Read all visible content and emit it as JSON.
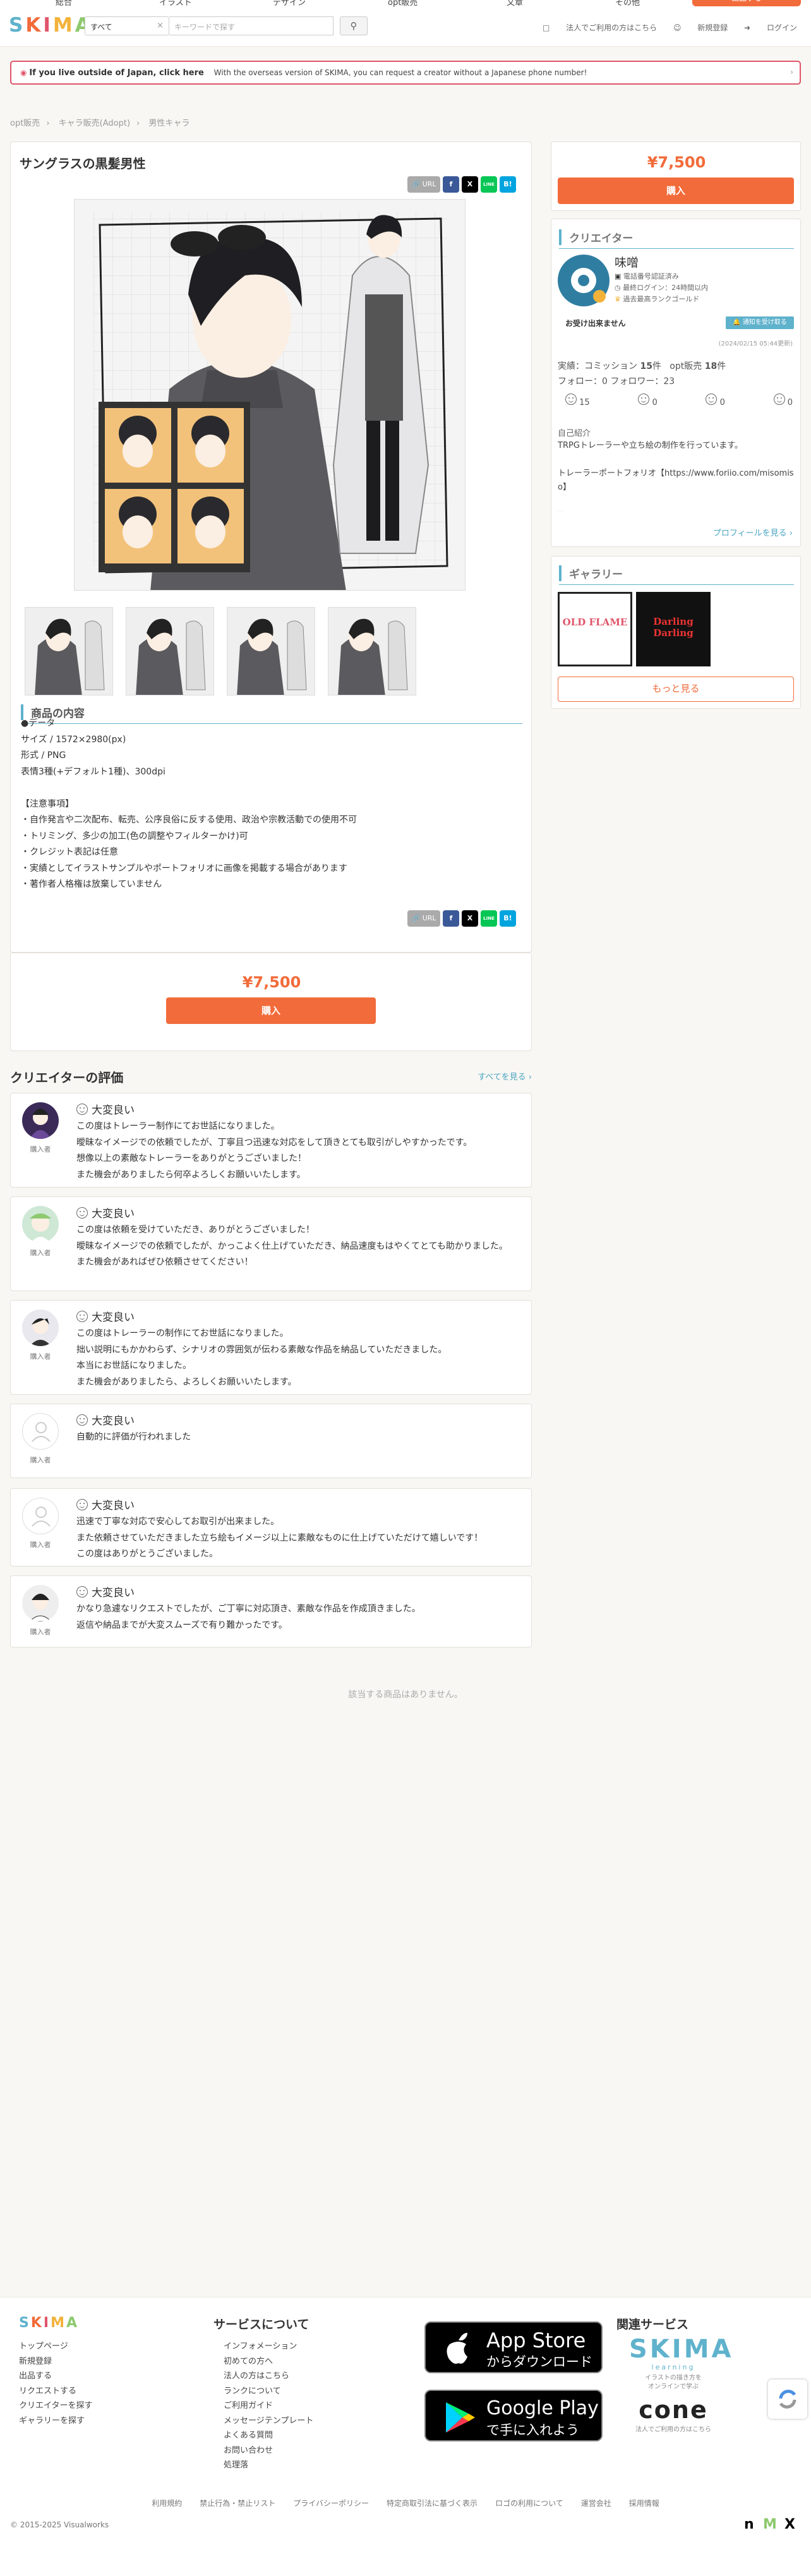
{
  "topnav": {
    "items": [
      "総合",
      "イラスト",
      "デザイン",
      "opt販売",
      "文章",
      "その他"
    ],
    "sell_label": "出品する"
  },
  "header": {
    "logo_letters": [
      {
        "ch": "S",
        "color": "#5fb2cc"
      },
      {
        "ch": "K",
        "color": "#f26b3a"
      },
      {
        "ch": "I",
        "color": "#e0556a"
      },
      {
        "ch": "M",
        "color": "#f2b23a"
      },
      {
        "ch": "A",
        "color": "#8dc96e"
      }
    ],
    "category": "すべて",
    "category_clear": "×",
    "search_placeholder": "キーワードで探す",
    "links": [
      "法人でご利用の方はこちら",
      "新規登録",
      "ログイン"
    ]
  },
  "notice": {
    "bold": "If you live outside of Japan, click here",
    "text": "With the overseas version of SKIMA, you can request a creator without a Japanese phone number!"
  },
  "breadcrumb": [
    "opt販売",
    "キャラ販売(Adopt)",
    "男性キャラ"
  ],
  "product": {
    "title": "サングラスの黒髪男性",
    "share": {
      "url": "URL",
      "facebook": "f",
      "x": "X",
      "line": "LINE",
      "hatena": "B!"
    },
    "section_title": "商品の内容",
    "description": "●データ\nサイズ / 1572×2980(px)\n形式 / PNG\n表情3種(+デフォルト1種)、300dpi\n\n【注意事項】\n・自作発言や二次配布、転売、公序良俗に反する使用、政治や宗教活動での使用不可\n・トリミング、多少の加工(色の調整やフィルターかけ)可\n・クレジット表記は任意\n・実績としてイラストサンプルやポートフォリオに画像を掲載する場合があります\n・著作者人格権は放棄していません",
    "price": "¥7,500",
    "buy_label": "購入"
  },
  "creator": {
    "section_title": "クリエイター",
    "name": "味噌",
    "verified": "電話番号認証済み",
    "last_login": "最終ログイン：24時間以内",
    "rank": "過去最高ランクゴールド",
    "status": "お受け出来ません",
    "notify_label": "通知を受け取る",
    "status_date": "(2024/02/15 05:44更新)",
    "stats": {
      "label_commission": "実績：コミッション",
      "commission": "15",
      "label_opt": "opt販売",
      "opt": "18",
      "unit": "件"
    },
    "follow_label": "フォロー：",
    "follow": "0",
    "follower_label": "フォロワー：",
    "follower": "23",
    "ratings": [
      "15",
      "0",
      "0",
      "0"
    ],
    "intro_label": "自己紹介",
    "intro": "TRPGトレーラーや立ち絵の制作を行っています。\n\nトレーラーポートフォリオ【https://www.foriio.com/misomiso】\n\nTwitter",
    "profile_link": "プロフィールを見る ›",
    "gallery_title": "ギャラリー",
    "gallery_captions": [
      "OLD FLAME",
      "Darling Darling"
    ],
    "more_label": "もっと見る"
  },
  "reviews": {
    "title": "クリエイターの評価",
    "see_all": "すべてを見る ›",
    "role": "購入者",
    "rating_label": "大変良い",
    "items": [
      "この度はトレーラー制作にてお世話になりました。\n曖昧なイメージでの依頼でしたが、丁寧且つ迅速な対応をして頂きとても取引がしやすかったです。\n想像以上の素敵なトレーラーをありがとうございました！\nまた機会がありましたら何卒よろしくお願いいたします。",
      "この度は依頼を受けていただき、ありがとうございました！\n曖昧なイメージでの依頼でしたが、かっこよく仕上げていただき、納品速度もはやくてとても助かりました。\nまた機会があればぜひ依頼させてください！",
      "この度はトレーラーの制作にてお世話になりました。\n拙い説明にもかかわらず、シナリオの雰囲気が伝わる素敵な作品を納品していただきました。\n本当にお世話になりました。\nまた機会がありましたら、よろしくお願いいたします。",
      "自動的に評価が行われました",
      "迅速で丁寧な対応で安心してお取引が出来ました。\nまた依頼させていただきました立ち絵もイメージ以上に素敵なものに仕上げていただけて嬉しいです！\nこの度はありがとうございました。",
      "かなり急遽なリクエストでしたが、ご丁寧に対応頂き、素敵な作品を作成頂きました。\n返信や納品までが大変スムーズで有り難かったです。"
    ]
  },
  "empty_text": "該当する商品はありません。",
  "footer": {
    "logo": "SKIMA",
    "col1": [
      "トップページ",
      "新規登録",
      "出品する",
      "リクエストする",
      "クリエイターを探す",
      "ギャラリーを探す"
    ],
    "services_title": "サービスについて",
    "col2": [
      "インフォメーション",
      "初めての方へ",
      "法人の方はこちら",
      "ランクについて",
      "ご利用ガイド",
      "メッセージテンプレート",
      "よくある質問",
      "お問い合わせ",
      "処理落"
    ],
    "appstore": {
      "l1": "App Store",
      "l2": "からダウンロード"
    },
    "googleplay": {
      "l1": "Google Play",
      "l2": "で手に入れよう"
    },
    "related_title": "関連サービス",
    "learning_logo": "SKIMA",
    "learning_sub": "learning",
    "learning_desc": "イラストの描き方を\nオンラインで学ぶ",
    "cone_logo": "cone",
    "cone_desc": "法人でご利用の方はこちら",
    "links": [
      "利用規約",
      "禁止行為・禁止リスト",
      "プライバシーポリシー",
      "特定商取引法に基づく表示",
      "ロゴの利用について",
      "運営会社",
      "採用情報"
    ],
    "copyright": "© 2015-2025 Visualworks",
    "social": [
      "n",
      "M",
      "X"
    ]
  }
}
